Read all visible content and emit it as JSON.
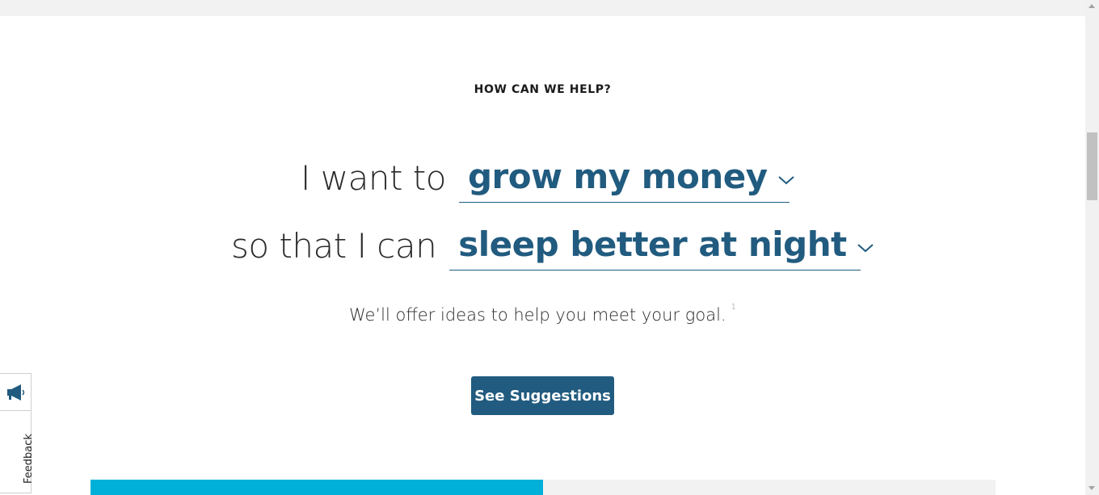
{
  "header": {
    "eyebrow": "HOW CAN WE HELP?"
  },
  "goal_selector": {
    "row1_prefix": "I want to",
    "row1_value": "grow my money",
    "row2_prefix": "so that I can",
    "row2_value": "sleep better at night"
  },
  "helper": {
    "text": "We’ll offer ideas to help you meet your goal.",
    "footnote": "1"
  },
  "cta": {
    "label": "See Suggestions"
  },
  "feedback_tab": {
    "label": "Feedback",
    "icon": "megaphone-icon"
  },
  "progress": {
    "fill_fraction": 0.5
  },
  "scrollbar": {
    "position_fraction": 0.27
  },
  "colors": {
    "brand": "#215b7f",
    "accent": "#00b0d8",
    "text": "#2a2a2a"
  }
}
